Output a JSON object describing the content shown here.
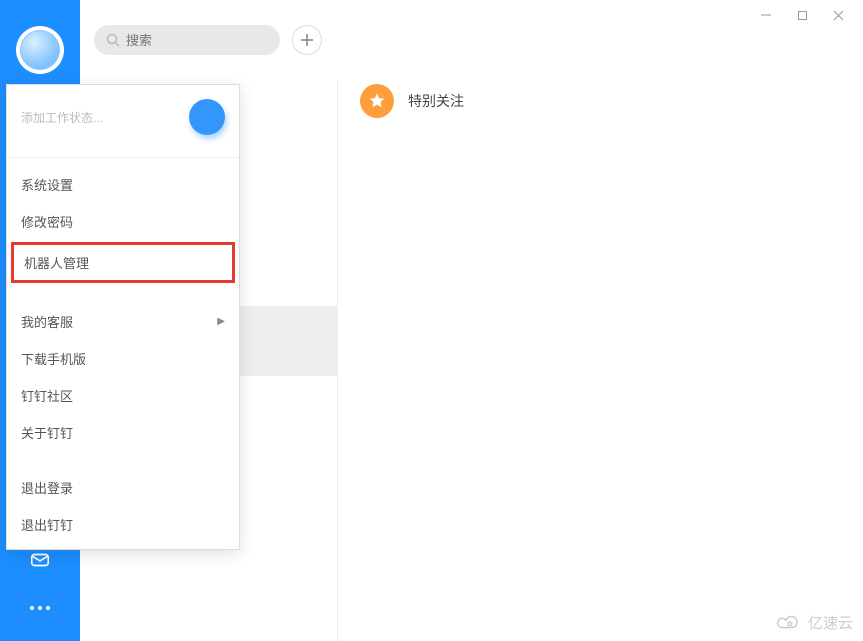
{
  "window": {
    "controls": {
      "minimize": "–",
      "maximize": "□",
      "close": "✕"
    }
  },
  "header": {
    "search_placeholder": "搜索",
    "plus_label": "+"
  },
  "popup": {
    "status_placeholder": "添加工作状态...",
    "items": {
      "system_settings": "系统设置",
      "change_password": "修改密码",
      "robot_management": "机器人管理",
      "my_service": "我的客服",
      "download_mobile": "下载手机版",
      "community": "钉钉社区",
      "about": "关于钉钉",
      "logout": "退出登录",
      "quit": "退出钉钉"
    }
  },
  "main": {
    "favorites_label": "特别关注"
  },
  "watermark": "亿速云"
}
